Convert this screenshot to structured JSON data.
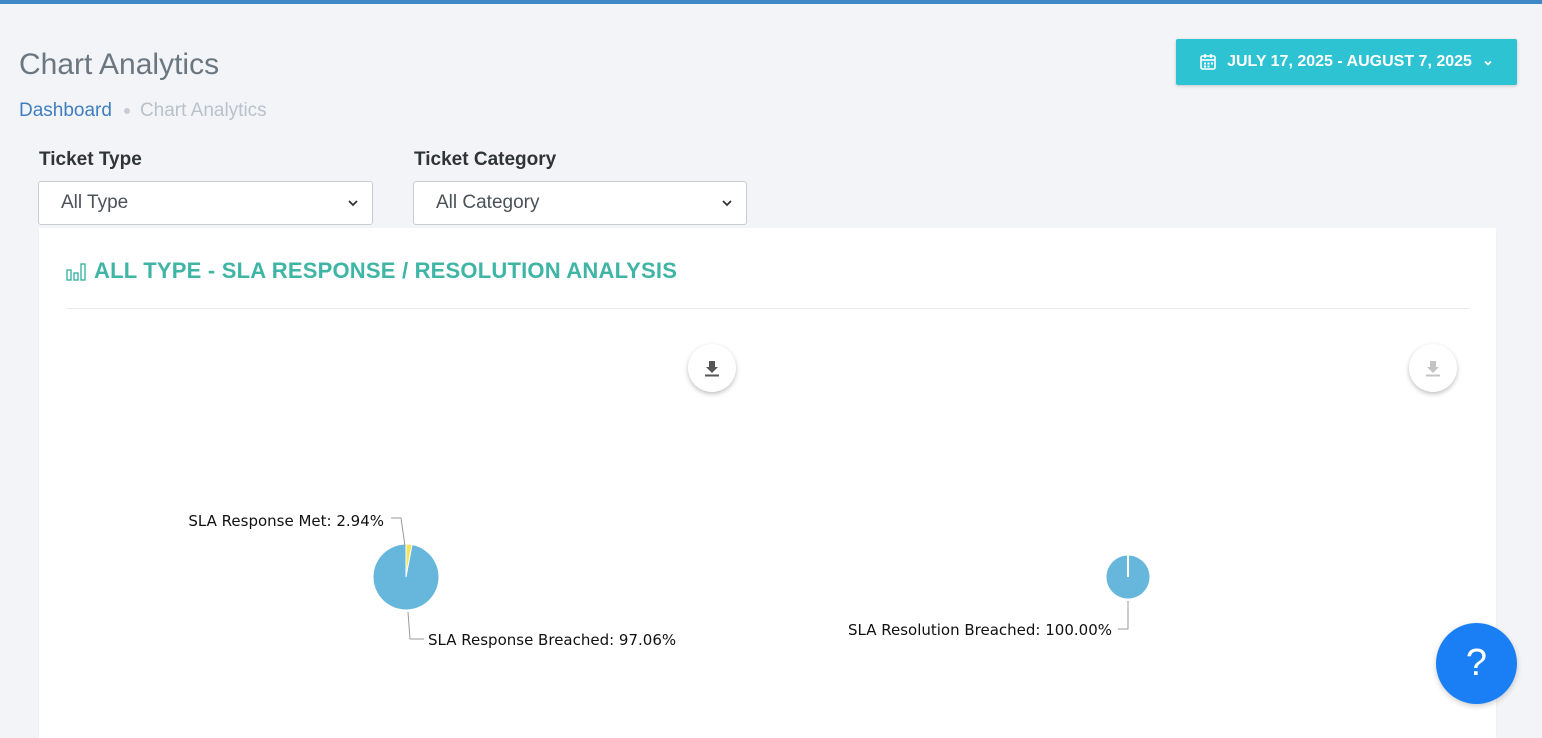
{
  "page": {
    "title": "Chart Analytics"
  },
  "breadcrumb": {
    "home": "Dashboard",
    "current": "Chart Analytics"
  },
  "date_range": {
    "label": "JULY 17, 2025 - AUGUST 7, 2025",
    "icon": "calendar-icon"
  },
  "filters": {
    "ticket_type": {
      "label": "Ticket Type",
      "value": "All Type"
    },
    "ticket_category": {
      "label": "Ticket Category",
      "value": "All Category"
    }
  },
  "card": {
    "title": "ALL TYPE - SLA RESPONSE / RESOLUTION ANALYSIS",
    "icon": "bar-chart-icon"
  },
  "help": {
    "label": "?"
  },
  "colors": {
    "accent": "#2dc3d3",
    "title": "#3fb5a6",
    "pie_main": "#67b6dc",
    "pie_met": "#f3e45a",
    "help": "#1a7ff5"
  },
  "chart_data": [
    {
      "type": "pie",
      "title": "",
      "slices": [
        {
          "label": "SLA Response Met",
          "value": 2.94,
          "display": "SLA Response Met: 2.94%"
        },
        {
          "label": "SLA Response Breached",
          "value": 97.06,
          "display": "SLA Response Breached: 97.06%"
        }
      ]
    },
    {
      "type": "pie",
      "title": "",
      "slices": [
        {
          "label": "SLA Resolution Breached",
          "value": 100.0,
          "display": "SLA Resolution Breached: 100.00%"
        }
      ]
    }
  ]
}
